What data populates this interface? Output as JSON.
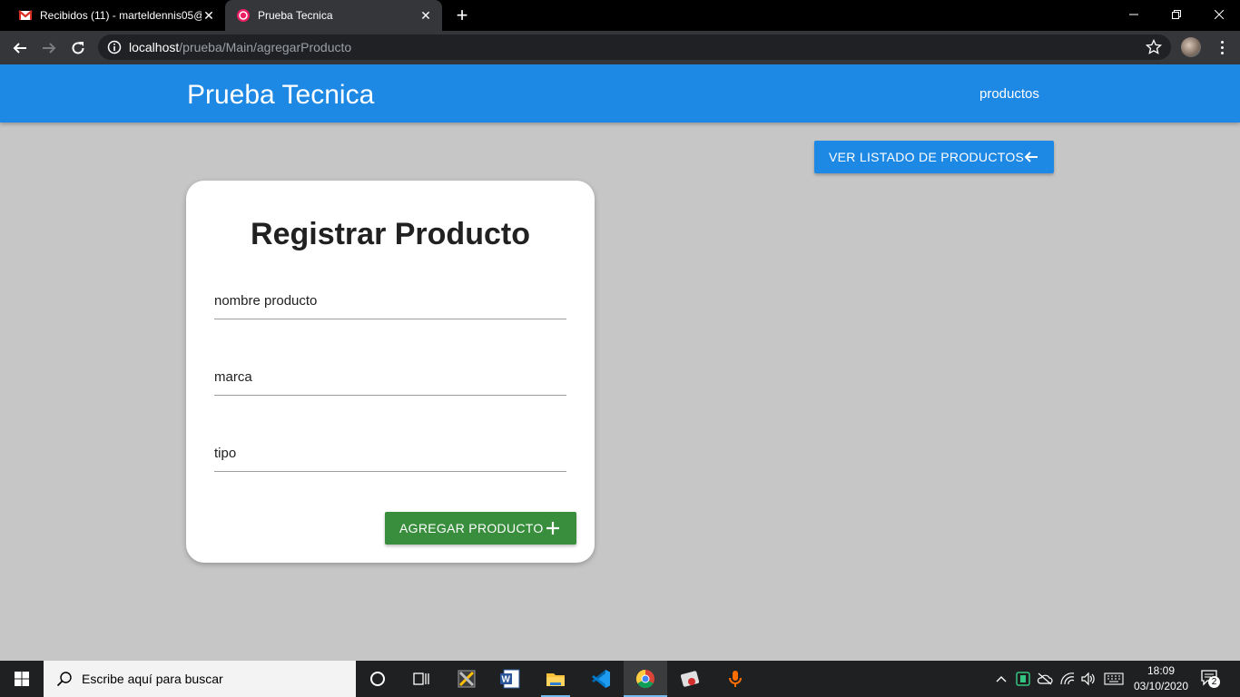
{
  "browser": {
    "tabs": [
      {
        "title": "Recibidos (11) - marteldennis05@",
        "favicon": "gmail-icon",
        "active": false
      },
      {
        "title": "Prueba Tecnica",
        "favicon": "site-favicon-icon",
        "active": true
      }
    ],
    "address": {
      "host": "localhost",
      "path": "/prueba/Main/agregarProducto"
    }
  },
  "app": {
    "brand": "Prueba Tecnica",
    "nav_link": "productos",
    "list_button_label": "VER LISTADO DE PRODUCTOS",
    "form": {
      "title": "Registrar Producto",
      "fields": [
        {
          "placeholder": "nombre producto",
          "value": ""
        },
        {
          "placeholder": "marca",
          "value": ""
        },
        {
          "placeholder": "tipo",
          "value": ""
        }
      ],
      "submit_label": "AGREGAR PRODUCTO"
    },
    "colors": {
      "primary": "#1e88e5",
      "success": "#388e3c",
      "background": "#c6c6c6"
    }
  },
  "taskbar": {
    "search_placeholder": "Escribe aquí para buscar",
    "apps": [
      "cortana-icon",
      "task-view-icon",
      "tools-icon",
      "word-icon",
      "file-explorer-icon",
      "vscode-icon",
      "chrome-icon",
      "app-icon",
      "microphone-icon"
    ],
    "time": "18:09",
    "date": "03/10/2020",
    "notification_count": "2"
  }
}
